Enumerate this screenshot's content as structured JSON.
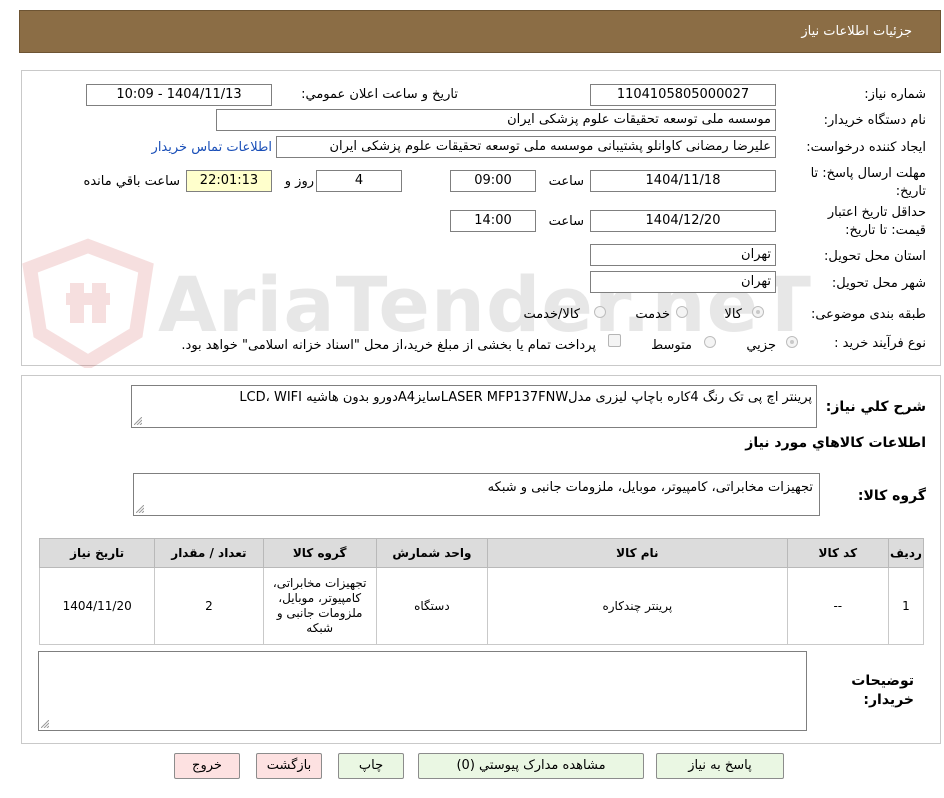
{
  "header": {
    "title": "جزئیات اطلاعات نیاز"
  },
  "watermark": {
    "text": "AriaTender.neT"
  },
  "info": {
    "need_number_label": "شماره نیاز:",
    "need_number": "1104105805000027",
    "announce_label": "تاریخ و ساعت اعلان عمومي:",
    "announce_value": "1404/11/13 - 10:09",
    "buyer_org_label": "نام دستگاه خریدار:",
    "buyer_org": "موسسه ملی توسعه تحقیقات علوم پزشکی ایران",
    "creator_label": "ایجاد کننده درخواست:",
    "creator": "علیرضا رمضانی کاوانلو پشتیبانی موسسه ملی توسعه تحقیقات علوم پزشکی ایران",
    "contact_link": "اطلاعات تماس خریدار",
    "deadline_label_1": "مهلت ارسال پاسخ: تا",
    "deadline_label_2": "تاریخ:",
    "deadline_date": "1404/11/18",
    "time_label": "ساعت",
    "deadline_time": "09:00",
    "days_value": "4",
    "days_label": "روز و",
    "remaining_time": "22:01:13",
    "remaining_label": "ساعت باقي مانده",
    "validity_label_1": "حداقل تاریخ اعتبار",
    "validity_label_2": "قیمت: تا تاریخ:",
    "validity_date": "1404/12/20",
    "validity_time": "14:00",
    "province_label": "استان محل تحویل:",
    "province": "تهران",
    "city_label": "شهر محل تحویل:",
    "city": "تهران",
    "category_label": "طبقه بندی موضوعی:",
    "category_options": [
      "کالا",
      "خدمت",
      "کالا/خدمت"
    ],
    "process_label": "نوع فرآیند خرید :",
    "process_options": [
      "جزيي",
      "متوسط"
    ],
    "payment_note": "پرداخت تمام یا بخشی از مبلغ خرید،از محل \"اسناد خزانه اسلامی\" خواهد بود."
  },
  "details": {
    "summary_label": "شرح کلي نیاز:",
    "summary": "پرینتر اچ پی تک رنگ 4کاره باچاپ لیزری مدلLASER MFP137FNWسایزA4دورو بدون هاشیه LCD، WIFI",
    "goods_info_title": "اطلاعات کالاهاي مورد نیاز",
    "goods_group_label": "گروه کالا:",
    "goods_group": "تجهیزات مخابراتی، کامپیوتر، موبایل، ملزومات جانبی و شبکه",
    "table": {
      "headers": [
        "ردیف",
        "کد کالا",
        "نام کالا",
        "واحد شمارش",
        "گروه کالا",
        "تعداد / مقدار",
        "تاریخ نیاز"
      ],
      "rows": [
        [
          "1",
          "--",
          "پرینتر چندکاره",
          "دستگاه",
          "تجهیزات مخابراتی، کامپیوتر، موبایل، ملزومات جانبی و شبکه",
          "2",
          "1404/11/20"
        ]
      ]
    },
    "buyer_notes_label_1": "توضیحات",
    "buyer_notes_label_2": "خریدار:"
  },
  "buttons": {
    "reply": "پاسخ به نیاز",
    "attachments": "مشاهده مدارک پیوستي (0)",
    "print": "چاپ",
    "back": "بازگشت",
    "exit": "خروج"
  }
}
